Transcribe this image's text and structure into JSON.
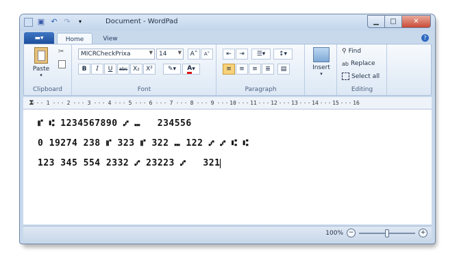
{
  "window": {
    "title": "Document - WordPad"
  },
  "tabs": {
    "file_label": "▬▾",
    "home": "Home",
    "view": "View",
    "help": "?"
  },
  "clipboard": {
    "paste": "Paste",
    "group": "Clipboard"
  },
  "font": {
    "name": "MICRCheckPrixa",
    "size": "14",
    "group": "Font",
    "bold": "B",
    "italic": "I",
    "underline": "U",
    "strike": "abc",
    "subscript": "X₂",
    "superscript": "X²",
    "grow": "A˄",
    "shrink": "A˅",
    "color": "A"
  },
  "paragraph": {
    "group": "Paragraph"
  },
  "insert": {
    "label": "Insert"
  },
  "editing": {
    "find": "Find",
    "replace": "Replace",
    "select_all": "Select all",
    "group": "Editing"
  },
  "ruler": {
    "numbers": [
      "1",
      "2",
      "3",
      "4",
      "5",
      "6",
      "7",
      "8",
      "9",
      "10",
      "11",
      "12",
      "13",
      "14",
      "15",
      "16"
    ]
  },
  "document": {
    "lines": [
      "⑈ ⑆ 1234567890 ⑇ ⑉   234556",
      "0 19274 238 ⑈ 323 ⑈ 322 ⑉ 122 ⑇ ⑇ ⑆ ⑆",
      "123 345 554 2332 ⑇ 23223 ⑇   32"
    ],
    "last_char": "1"
  },
  "status": {
    "zoom": "100%"
  },
  "zoom_level": 1.0,
  "icons": [
    "save-icon",
    "undo-icon",
    "redo-icon",
    "paste-icon",
    "cut-icon",
    "copy-icon",
    "find-icon",
    "replace-icon",
    "select-all-icon",
    "picture-icon"
  ]
}
